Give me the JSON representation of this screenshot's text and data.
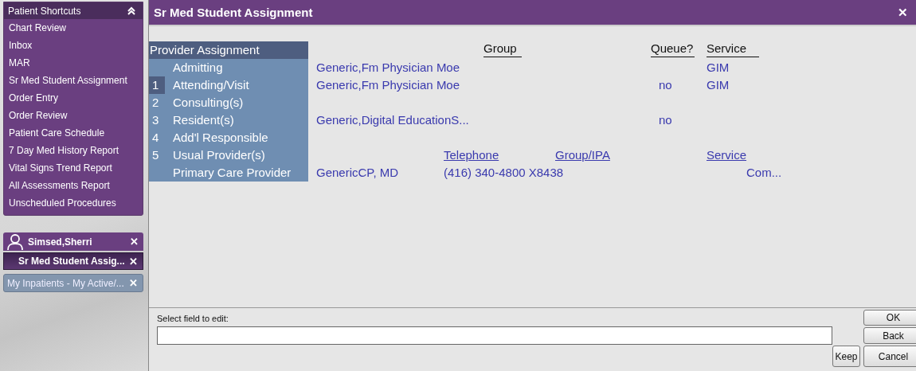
{
  "sidebar": {
    "shortcuts": {
      "title": "Patient Shortcuts",
      "expanded": true,
      "items": [
        {
          "label": "Chart Review"
        },
        {
          "label": "Inbox"
        },
        {
          "label": "MAR"
        },
        {
          "label": "Sr Med Student Assignment"
        },
        {
          "label": "Order Entry"
        },
        {
          "label": "Order Review"
        },
        {
          "label": "Patient Care Schedule"
        },
        {
          "label": "7 Day Med History Report"
        },
        {
          "label": "Vital Signs Trend Report"
        },
        {
          "label": "All Assessments Report"
        },
        {
          "label": "Unscheduled Procedures"
        }
      ]
    },
    "patient_tab": {
      "name": "Simsed,Sherri",
      "close": "✕",
      "activities": [
        {
          "label": "Sr Med Student Assig...",
          "selected": true,
          "close": "✕"
        }
      ]
    },
    "other_tabs": [
      {
        "label": "My Inpatients - My Active/...",
        "selected": false,
        "close": "✕"
      }
    ]
  },
  "window": {
    "title": "Sr Med Student Assignment",
    "close": "✕"
  },
  "provider_assignment": {
    "title": "Provider Assignment",
    "headers": {
      "group": "Group",
      "queue": "Queue?",
      "service": "Service"
    },
    "rows": [
      {
        "label": "Admitting",
        "selected": false,
        "provider": "Generic,Fm Physician Moe",
        "service": "GIM"
      },
      {
        "number": "1",
        "label": "Attending/Visit",
        "selected": true,
        "provider": "Generic,Fm Physician Moe",
        "queue": "no",
        "service": "GIM"
      },
      {
        "number": "2",
        "label": "Consulting(s)",
        "selected": false
      },
      {
        "number": "3",
        "label": "Resident(s)",
        "selected": false,
        "provider": "Generic,Digital EducationS...",
        "queue": "no"
      },
      {
        "number": "4",
        "label": "Add'l Responsible",
        "selected": false
      }
    ],
    "usual_provider": {
      "number": "5",
      "label": "Usual Provider(s)",
      "telephone": "Telephone",
      "group_ipa": "Group/IPA",
      "service": "Service"
    },
    "primary_care": {
      "label": "Primary Care Provider",
      "provider": "GenericCP, MD",
      "telephone": "(416) 340-4800 X8438",
      "service": "Com..."
    }
  },
  "edit": {
    "label": "Select field to edit:"
  },
  "buttons": {
    "ok": "OK",
    "back": "Back",
    "keep": "Keep",
    "cancel": "Cancel"
  }
}
